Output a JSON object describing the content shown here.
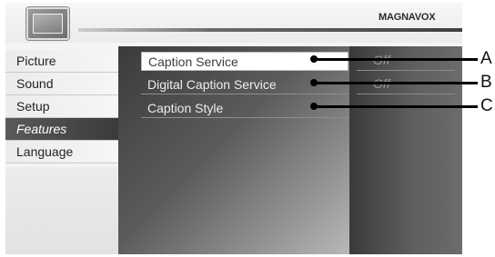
{
  "header": {
    "brand": "MAGNAVOX",
    "icon": "tv-icon"
  },
  "left_menu": {
    "items": [
      {
        "label": "Picture",
        "active": false
      },
      {
        "label": "Sound",
        "active": false
      },
      {
        "label": "Setup",
        "active": false
      },
      {
        "label": "Features",
        "active": true
      },
      {
        "label": "Language",
        "active": false
      }
    ]
  },
  "submenu": {
    "items": [
      {
        "label": "Caption Service",
        "selected": true
      },
      {
        "label": "Digital Caption Service",
        "selected": false
      },
      {
        "label": "Caption Style",
        "selected": false
      }
    ]
  },
  "values": {
    "items": [
      {
        "label": "Off"
      },
      {
        "label": "Off"
      }
    ]
  },
  "callouts": [
    "A",
    "B",
    "C"
  ],
  "colors": {
    "active_menu": "#4a4a4a",
    "selected_item": "#ffffff",
    "text_light": "#eeeeee"
  }
}
